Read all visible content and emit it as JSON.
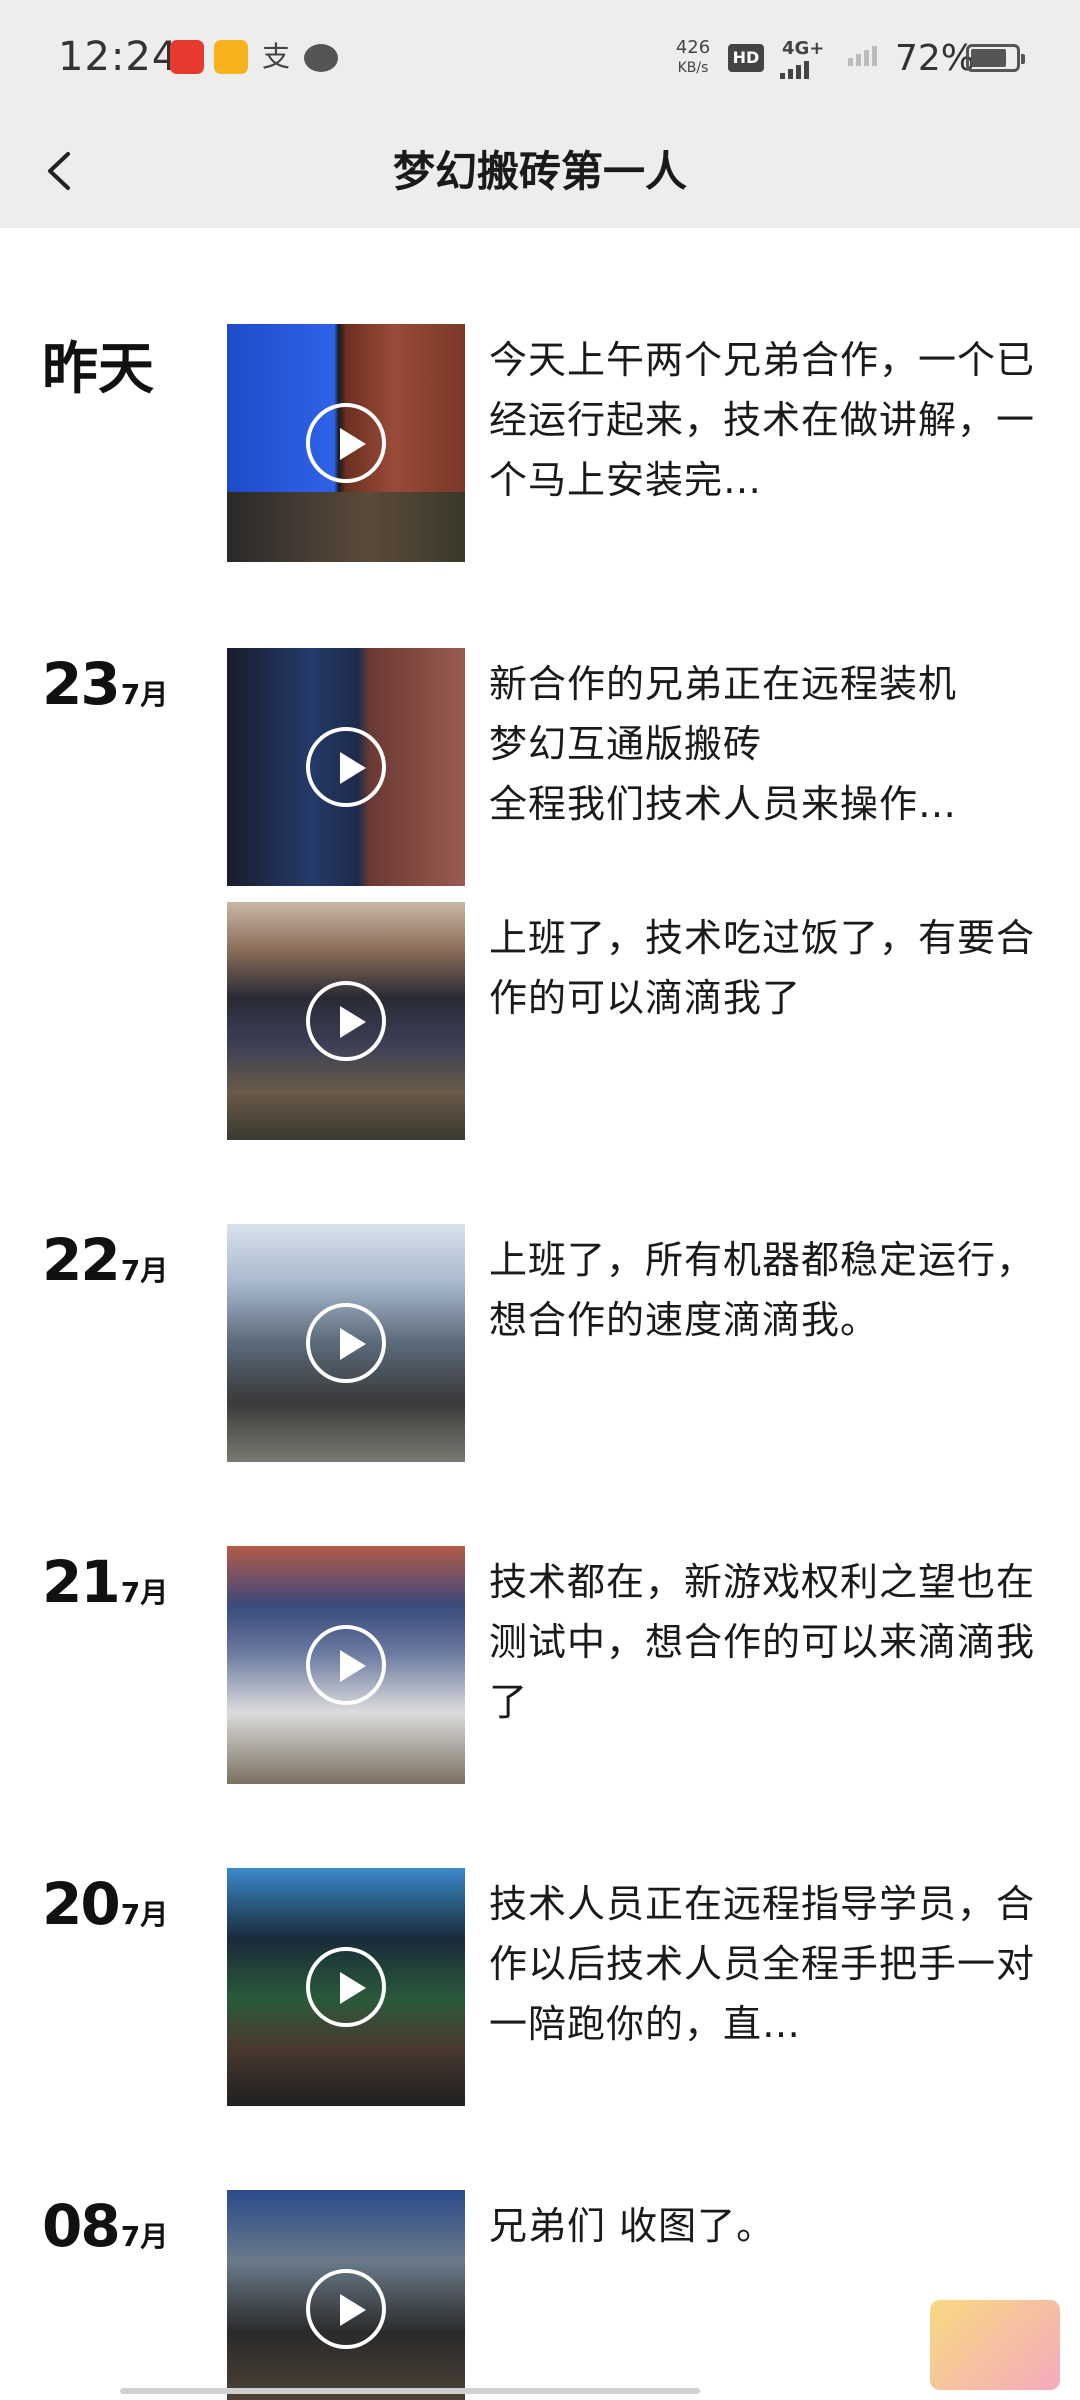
{
  "status_bar": {
    "time": "12:24",
    "net_speed_value": "426",
    "net_speed_unit": "KB/s",
    "hd_label": "HD",
    "network_type": "4G+",
    "battery_text": "72%",
    "battery_level": 0.72
  },
  "header": {
    "title": "梦幻搬砖第一人"
  },
  "feed": [
    {
      "date_label": "昨天",
      "posts": [
        {
          "text": "今天上午两个兄弟合作，一个已经运行起来，技术在做讲解，一个马上安装完…"
        }
      ]
    },
    {
      "day": "23",
      "month": "7月",
      "posts": [
        {
          "text": "新合作的兄弟正在远程装机\n梦幻互通版搬砖\n全程我们技术人员来操作…"
        },
        {
          "text": "上班了，技术吃过饭了，有要合作的可以滴滴我了"
        }
      ]
    },
    {
      "day": "22",
      "month": "7月",
      "posts": [
        {
          "text": "上班了，所有机器都稳定运行，想合作的速度滴滴我。"
        }
      ]
    },
    {
      "day": "21",
      "month": "7月",
      "posts": [
        {
          "text": "技术都在，新游戏权利之望也在测试中，想合作的可以来滴滴我了"
        }
      ]
    },
    {
      "day": "20",
      "month": "7月",
      "posts": [
        {
          "text": "技术人员正在远程指导学员，合作以后技术人员全程手把手一对一陪跑你的，直…"
        }
      ]
    },
    {
      "day": "08",
      "month": "7月",
      "posts": [
        {
          "text": "兄弟们  收图了。"
        }
      ]
    }
  ]
}
